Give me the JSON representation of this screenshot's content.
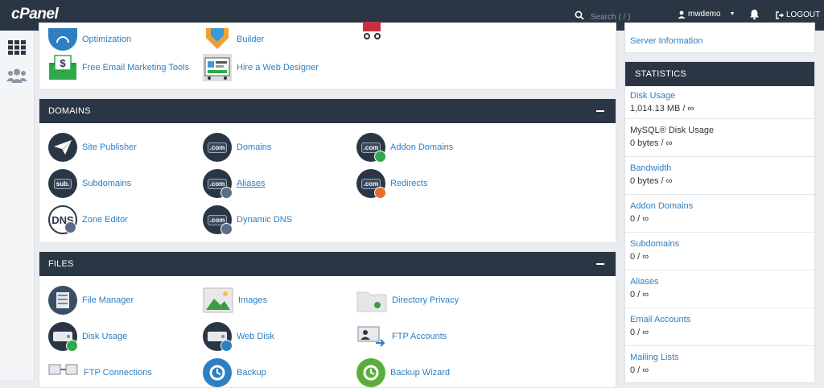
{
  "topbar": {
    "logo": "cPanel",
    "search_placeholder": "Search ( / )",
    "username": "mwdemo",
    "logout": "LOGOUT"
  },
  "top_panel": {
    "items": [
      {
        "label": "Optimization"
      },
      {
        "label": "Builder"
      },
      {
        "label": "Free Email Marketing Tools"
      },
      {
        "label": "Hire a Web Designer"
      }
    ]
  },
  "domains": {
    "title": "DOMAINS",
    "items": [
      {
        "label": "Site Publisher"
      },
      {
        "label": "Domains"
      },
      {
        "label": "Addon Domains"
      },
      {
        "label": "Subdomains"
      },
      {
        "label": "Aliases"
      },
      {
        "label": "Redirects"
      },
      {
        "label": "Zone Editor"
      },
      {
        "label": "Dynamic DNS"
      }
    ]
  },
  "files": {
    "title": "FILES",
    "items": [
      {
        "label": "File Manager"
      },
      {
        "label": "Images"
      },
      {
        "label": "Directory Privacy"
      },
      {
        "label": "Disk Usage"
      },
      {
        "label": "Web Disk"
      },
      {
        "label": "FTP Accounts"
      },
      {
        "label": "FTP Connections"
      },
      {
        "label": "Backup"
      },
      {
        "label": "Backup Wizard"
      }
    ]
  },
  "sidebar": {
    "server_info_link": "Server Information",
    "statistics_title": "STATISTICS",
    "stats": [
      {
        "label": "Disk Usage",
        "value": "1,014.13 MB / ∞"
      },
      {
        "label": "MySQL® Disk Usage",
        "value": "0 bytes / ∞"
      },
      {
        "label": "Bandwidth",
        "value": "0 bytes / ∞"
      },
      {
        "label": "Addon Domains",
        "value": "0 / ∞"
      },
      {
        "label": "Subdomains",
        "value": "0 / ∞"
      },
      {
        "label": "Aliases",
        "value": "0 / ∞"
      },
      {
        "label": "Email Accounts",
        "value": "0 / ∞"
      },
      {
        "label": "Mailing Lists",
        "value": "0 / ∞"
      }
    ]
  },
  "colors": {
    "header_bg": "#2b3644",
    "link": "#2d7fc2",
    "page_bg": "#eaecef"
  }
}
